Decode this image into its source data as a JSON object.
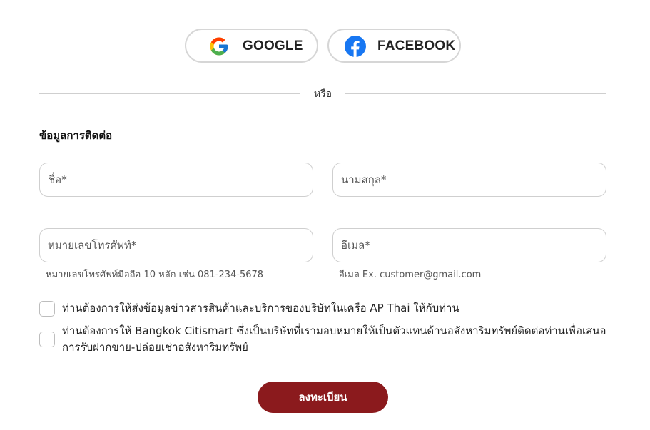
{
  "social": {
    "google": {
      "label": "GOOGLE",
      "icon": "google-icon"
    },
    "facebook": {
      "label": "FACEBOOK",
      "icon": "facebook-icon",
      "color": "#1877F2"
    }
  },
  "divider": {
    "text": "หรือ"
  },
  "contact": {
    "title": "ข้อมูลการติดต่อ",
    "first_name": {
      "placeholder": "ชื่อ*",
      "value": ""
    },
    "last_name": {
      "placeholder": "นามสกุล*",
      "value": ""
    },
    "phone": {
      "placeholder": "หมายเลขโทรศัพท์*",
      "value": "",
      "hint": "หมายเลขโทรศัพท์มือถือ 10 หลัก เช่น 081-234-5678"
    },
    "email": {
      "placeholder": "อีเมล*",
      "value": "",
      "hint": "อีเมล Ex. customer@gmail.com"
    }
  },
  "consents": [
    {
      "text": "ท่านต้องการให้ส่งข้อมูลข่าวสารสินค้าและบริการของบริษัทในเครือ AP Thai ให้กับท่าน",
      "checked": false
    },
    {
      "text": "ท่านต้องการให้ Bangkok Citismart ซึ่งเป็นบริษัทที่เรามอบหมายให้เป็นตัวแทนด้านอสังหาริมทรัพย์ติดต่อท่านเพื่อเสนอการรับฝากขาย-ปล่อยเช่าอสังหาริมทรัพย์",
      "checked": false
    }
  ],
  "submit": {
    "label": "ลงทะเบียน",
    "color": "#8B1A1D"
  }
}
